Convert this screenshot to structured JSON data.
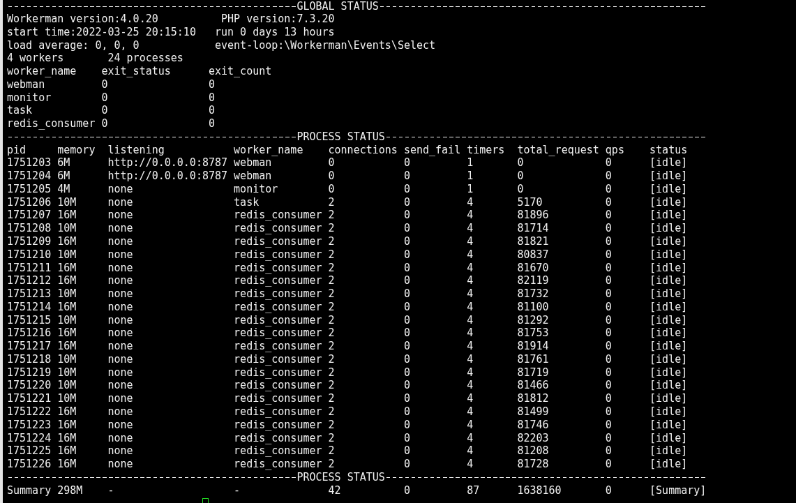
{
  "global_status": {
    "title": "GLOBAL STATUS",
    "info_lines": [
      {
        "left": "Workerman version:4.0.20",
        "right": "PHP version:7.3.20"
      },
      {
        "left": "start time:2022-03-25 20:15:10",
        "right": "run 0 days 13 hours"
      },
      {
        "left": "load average: 0, 0, 0",
        "right": "event-loop:\\Workerman\\Events\\Select"
      },
      {
        "left": "4 workers",
        "right": "24 processes"
      }
    ],
    "worker_table": {
      "columns": [
        "worker_name",
        "exit_status",
        "exit_count"
      ],
      "rows": [
        [
          "webman",
          "0",
          "0"
        ],
        [
          "monitor",
          "0",
          "0"
        ],
        [
          "task",
          "0",
          "0"
        ],
        [
          "redis_consumer",
          "0",
          "0"
        ]
      ]
    }
  },
  "process_status": {
    "title": "PROCESS STATUS",
    "columns": [
      "pid",
      "memory",
      "listening",
      "worker_name",
      "connections",
      "send_fail",
      "timers",
      "total_request",
      "qps",
      "status"
    ],
    "rows": [
      [
        "1751203",
        "6M",
        "http://0.0.0.0:8787",
        "webman",
        "0",
        "0",
        "1",
        "0",
        "0",
        "[idle]"
      ],
      [
        "1751204",
        "6M",
        "http://0.0.0.0:8787",
        "webman",
        "0",
        "0",
        "1",
        "0",
        "0",
        "[idle]"
      ],
      [
        "1751205",
        "4M",
        "none",
        "monitor",
        "0",
        "0",
        "1",
        "0",
        "0",
        "[idle]"
      ],
      [
        "1751206",
        "10M",
        "none",
        "task",
        "2",
        "0",
        "4",
        "5170",
        "0",
        "[idle]"
      ],
      [
        "1751207",
        "16M",
        "none",
        "redis_consumer",
        "2",
        "0",
        "4",
        "81896",
        "0",
        "[idle]"
      ],
      [
        "1751208",
        "10M",
        "none",
        "redis_consumer",
        "2",
        "0",
        "4",
        "81714",
        "0",
        "[idle]"
      ],
      [
        "1751209",
        "16M",
        "none",
        "redis_consumer",
        "2",
        "0",
        "4",
        "81821",
        "0",
        "[idle]"
      ],
      [
        "1751210",
        "10M",
        "none",
        "redis_consumer",
        "2",
        "0",
        "4",
        "80837",
        "0",
        "[idle]"
      ],
      [
        "1751211",
        "16M",
        "none",
        "redis_consumer",
        "2",
        "0",
        "4",
        "81670",
        "0",
        "[idle]"
      ],
      [
        "1751212",
        "16M",
        "none",
        "redis_consumer",
        "2",
        "0",
        "4",
        "82119",
        "0",
        "[idle]"
      ],
      [
        "1751213",
        "10M",
        "none",
        "redis_consumer",
        "2",
        "0",
        "4",
        "81732",
        "0",
        "[idle]"
      ],
      [
        "1751214",
        "16M",
        "none",
        "redis_consumer",
        "2",
        "0",
        "4",
        "81100",
        "0",
        "[idle]"
      ],
      [
        "1751215",
        "10M",
        "none",
        "redis_consumer",
        "2",
        "0",
        "4",
        "81292",
        "0",
        "[idle]"
      ],
      [
        "1751216",
        "16M",
        "none",
        "redis_consumer",
        "2",
        "0",
        "4",
        "81753",
        "0",
        "[idle]"
      ],
      [
        "1751217",
        "16M",
        "none",
        "redis_consumer",
        "2",
        "0",
        "4",
        "81914",
        "0",
        "[idle]"
      ],
      [
        "1751218",
        "10M",
        "none",
        "redis_consumer",
        "2",
        "0",
        "4",
        "81761",
        "0",
        "[idle]"
      ],
      [
        "1751219",
        "10M",
        "none",
        "redis_consumer",
        "2",
        "0",
        "4",
        "81719",
        "0",
        "[idle]"
      ],
      [
        "1751220",
        "10M",
        "none",
        "redis_consumer",
        "2",
        "0",
        "4",
        "81466",
        "0",
        "[idle]"
      ],
      [
        "1751221",
        "10M",
        "none",
        "redis_consumer",
        "2",
        "0",
        "4",
        "81812",
        "0",
        "[idle]"
      ],
      [
        "1751222",
        "16M",
        "none",
        "redis_consumer",
        "2",
        "0",
        "4",
        "81499",
        "0",
        "[idle]"
      ],
      [
        "1751223",
        "16M",
        "none",
        "redis_consumer",
        "2",
        "0",
        "4",
        "81746",
        "0",
        "[idle]"
      ],
      [
        "1751224",
        "16M",
        "none",
        "redis_consumer",
        "2",
        "0",
        "4",
        "82203",
        "0",
        "[idle]"
      ],
      [
        "1751225",
        "16M",
        "none",
        "redis_consumer",
        "2",
        "0",
        "4",
        "81208",
        "0",
        "[idle]"
      ],
      [
        "1751226",
        "16M",
        "none",
        "redis_consumer",
        "2",
        "0",
        "4",
        "81728",
        "0",
        "[idle]"
      ]
    ]
  },
  "summary": {
    "title": "PROCESS STATUS",
    "cells": [
      "Summary",
      "298M",
      "-",
      "-",
      "42",
      "0",
      "87",
      "1638160",
      "0",
      "[Summary]"
    ]
  }
}
